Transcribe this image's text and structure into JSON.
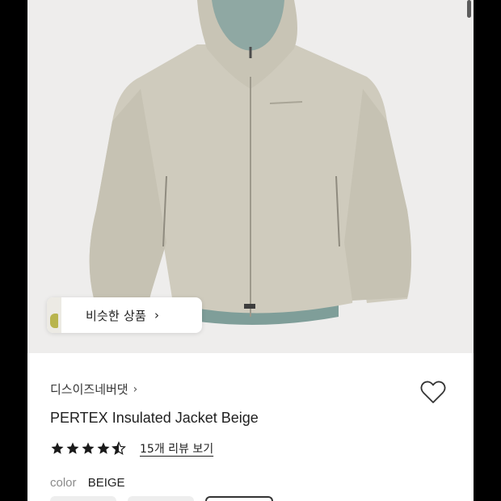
{
  "similar_chip": {
    "label": "비슷한 상품",
    "chevron": "›",
    "icon": "chevron-right-icon"
  },
  "brand": {
    "name": "디스이즈네버댓",
    "chevron": "›"
  },
  "wishlist": {
    "icon": "heart-icon"
  },
  "product": {
    "title": "PERTEX Insulated Jacket Beige"
  },
  "rating": {
    "stars": 4.5,
    "max": 5,
    "reviews_label": "15개 리뷰 보기"
  },
  "color": {
    "key": "color",
    "value": "BEIGE"
  },
  "colors": {
    "accent_star": "#1a1a1a",
    "jacket": "#cfcbbd",
    "lining": "#7f9e99"
  }
}
